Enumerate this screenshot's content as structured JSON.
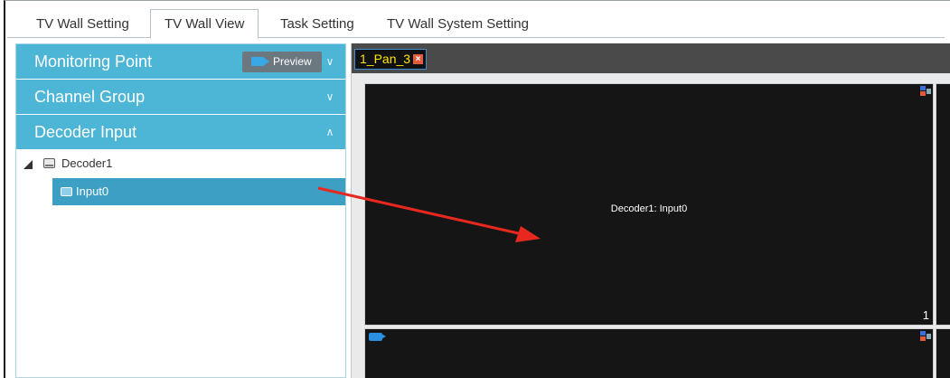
{
  "tabs": [
    {
      "label": "TV Wall Setting"
    },
    {
      "label": "TV Wall View"
    },
    {
      "label": "Task Setting"
    },
    {
      "label": "TV Wall System Setting"
    }
  ],
  "left_panel": {
    "accordion": [
      {
        "label": "Monitoring Point",
        "chevron": "chevron-down-icon"
      },
      {
        "label": "Channel Group",
        "chevron": "chevron-down-icon"
      },
      {
        "label": "Decoder Input",
        "chevron": "chevron-up-icon"
      }
    ],
    "preview_button": "Preview",
    "tree": {
      "root": "Decoder1",
      "child": "Input0"
    }
  },
  "wall": {
    "tab_label": "1_Pan_3",
    "cells": [
      {
        "label": "Decoder1: Input0",
        "number": "1"
      }
    ]
  },
  "colors": {
    "accent": "#4db5d6",
    "selected": "#3d9fc4",
    "tab_text": "#ffe600",
    "arrow": "#e8281e"
  }
}
